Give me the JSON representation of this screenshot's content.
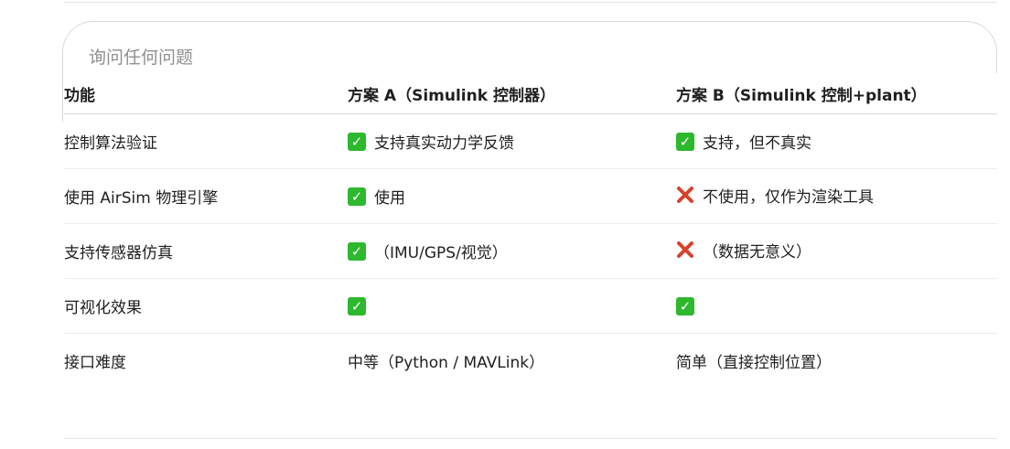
{
  "composer": {
    "placeholder": "询问任何问题"
  },
  "table": {
    "headers": [
      "功能",
      "方案 A（Simulink 控制器）",
      "方案 B（Simulink 控制+plant）"
    ],
    "rows": [
      {
        "feature": "控制算法验证",
        "a": {
          "icon": "check-icon",
          "text": "支持真实动力学反馈"
        },
        "b": {
          "icon": "check-icon",
          "text": "支持，但不真实"
        }
      },
      {
        "feature": "使用 AirSim 物理引擎",
        "a": {
          "icon": "check-icon",
          "text": "使用"
        },
        "b": {
          "icon": "cross-icon",
          "text": "不使用，仅作为渲染工具"
        }
      },
      {
        "feature": "支持传感器仿真",
        "a": {
          "icon": "check-icon",
          "text": "（IMU/GPS/视觉）"
        },
        "b": {
          "icon": "cross-icon",
          "text": "（数据无意义）"
        }
      },
      {
        "feature": "可视化效果",
        "a": {
          "icon": "check-icon",
          "text": ""
        },
        "b": {
          "icon": "check-icon",
          "text": ""
        }
      },
      {
        "feature": "接口难度",
        "a": {
          "icon": "",
          "text": "中等（Python / MAVLink）"
        },
        "b": {
          "icon": "",
          "text": "简单（直接控制位置）"
        }
      }
    ]
  },
  "colors": {
    "check": "#2db82d",
    "cross": "#d9412b"
  }
}
